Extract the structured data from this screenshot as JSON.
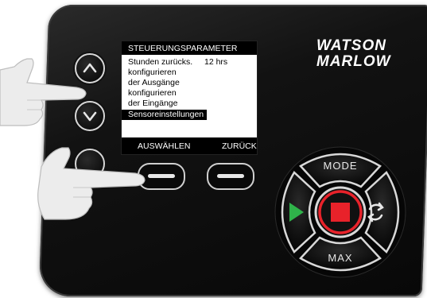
{
  "brand": {
    "line1": "WATSON",
    "line2": "MARLOW"
  },
  "screen": {
    "title": "STEUERUNGSPARAMETER",
    "items": [
      {
        "label": "Stunden zurücks.",
        "value": "12 hrs"
      },
      {
        "label": "konfigurieren",
        "value": ""
      },
      {
        "label": "der Ausgänge",
        "value": ""
      },
      {
        "label": "konfigurieren",
        "value": ""
      },
      {
        "label": "der Eingänge",
        "value": ""
      },
      {
        "label": "Sensoreinstellungen",
        "value": ""
      }
    ],
    "selected_index": 5,
    "softkeys": {
      "left": "AUSWÄHLEN",
      "right": "ZURÜCK"
    }
  },
  "keypad": {
    "mode_label": "MODE",
    "max_label": "MAX"
  },
  "colors": {
    "run_green": "#2fb34a",
    "stop_red": "#e8222a",
    "panel": "#111111",
    "button_ring": "#d8d8d8"
  },
  "icons": [
    "up-arrow-icon",
    "down-arrow-icon",
    "play-icon",
    "stop-icon",
    "reverse-icon",
    "pointing-hand-icon"
  ]
}
